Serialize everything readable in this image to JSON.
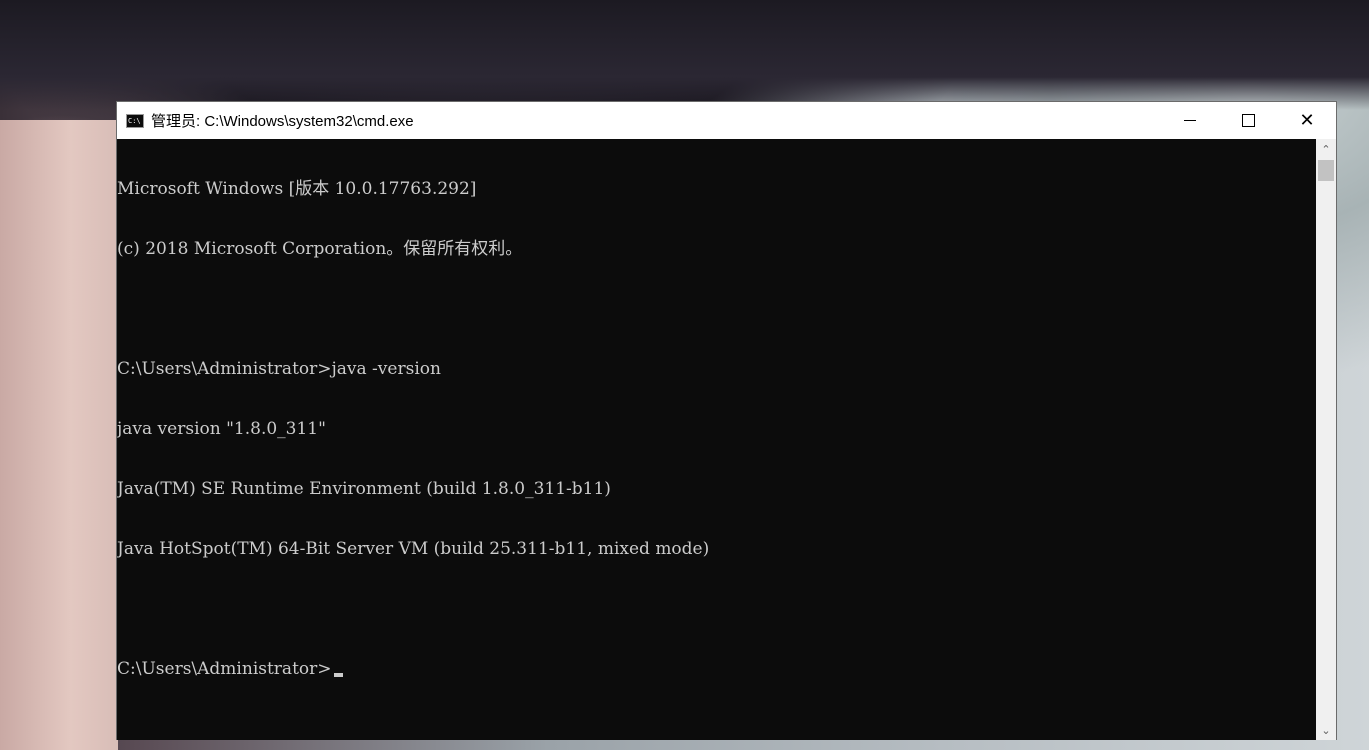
{
  "window": {
    "title": "管理员: C:\\Windows\\system32\\cmd.exe",
    "icon": "cmd-icon",
    "icon_text": "C:\\",
    "minimize_glyph": "",
    "close_glyph": "✕"
  },
  "console": {
    "lines": [
      "Microsoft Windows [版本 10.0.17763.292]",
      "(c) 2018 Microsoft Corporation。保留所有权利。",
      "",
      "C:\\Users\\Administrator>java -version",
      "java version \"1.8.0_311\"",
      "Java(TM) SE Runtime Environment (build 1.8.0_311-b11)",
      "Java HotSpot(TM) 64-Bit Server VM (build 25.311-b11, mixed mode)",
      "",
      "C:\\Users\\Administrator>"
    ],
    "background": "#0c0c0c",
    "foreground": "#cccccc"
  },
  "scrollbar": {
    "up_glyph": "⌃",
    "down_glyph": "⌄"
  }
}
